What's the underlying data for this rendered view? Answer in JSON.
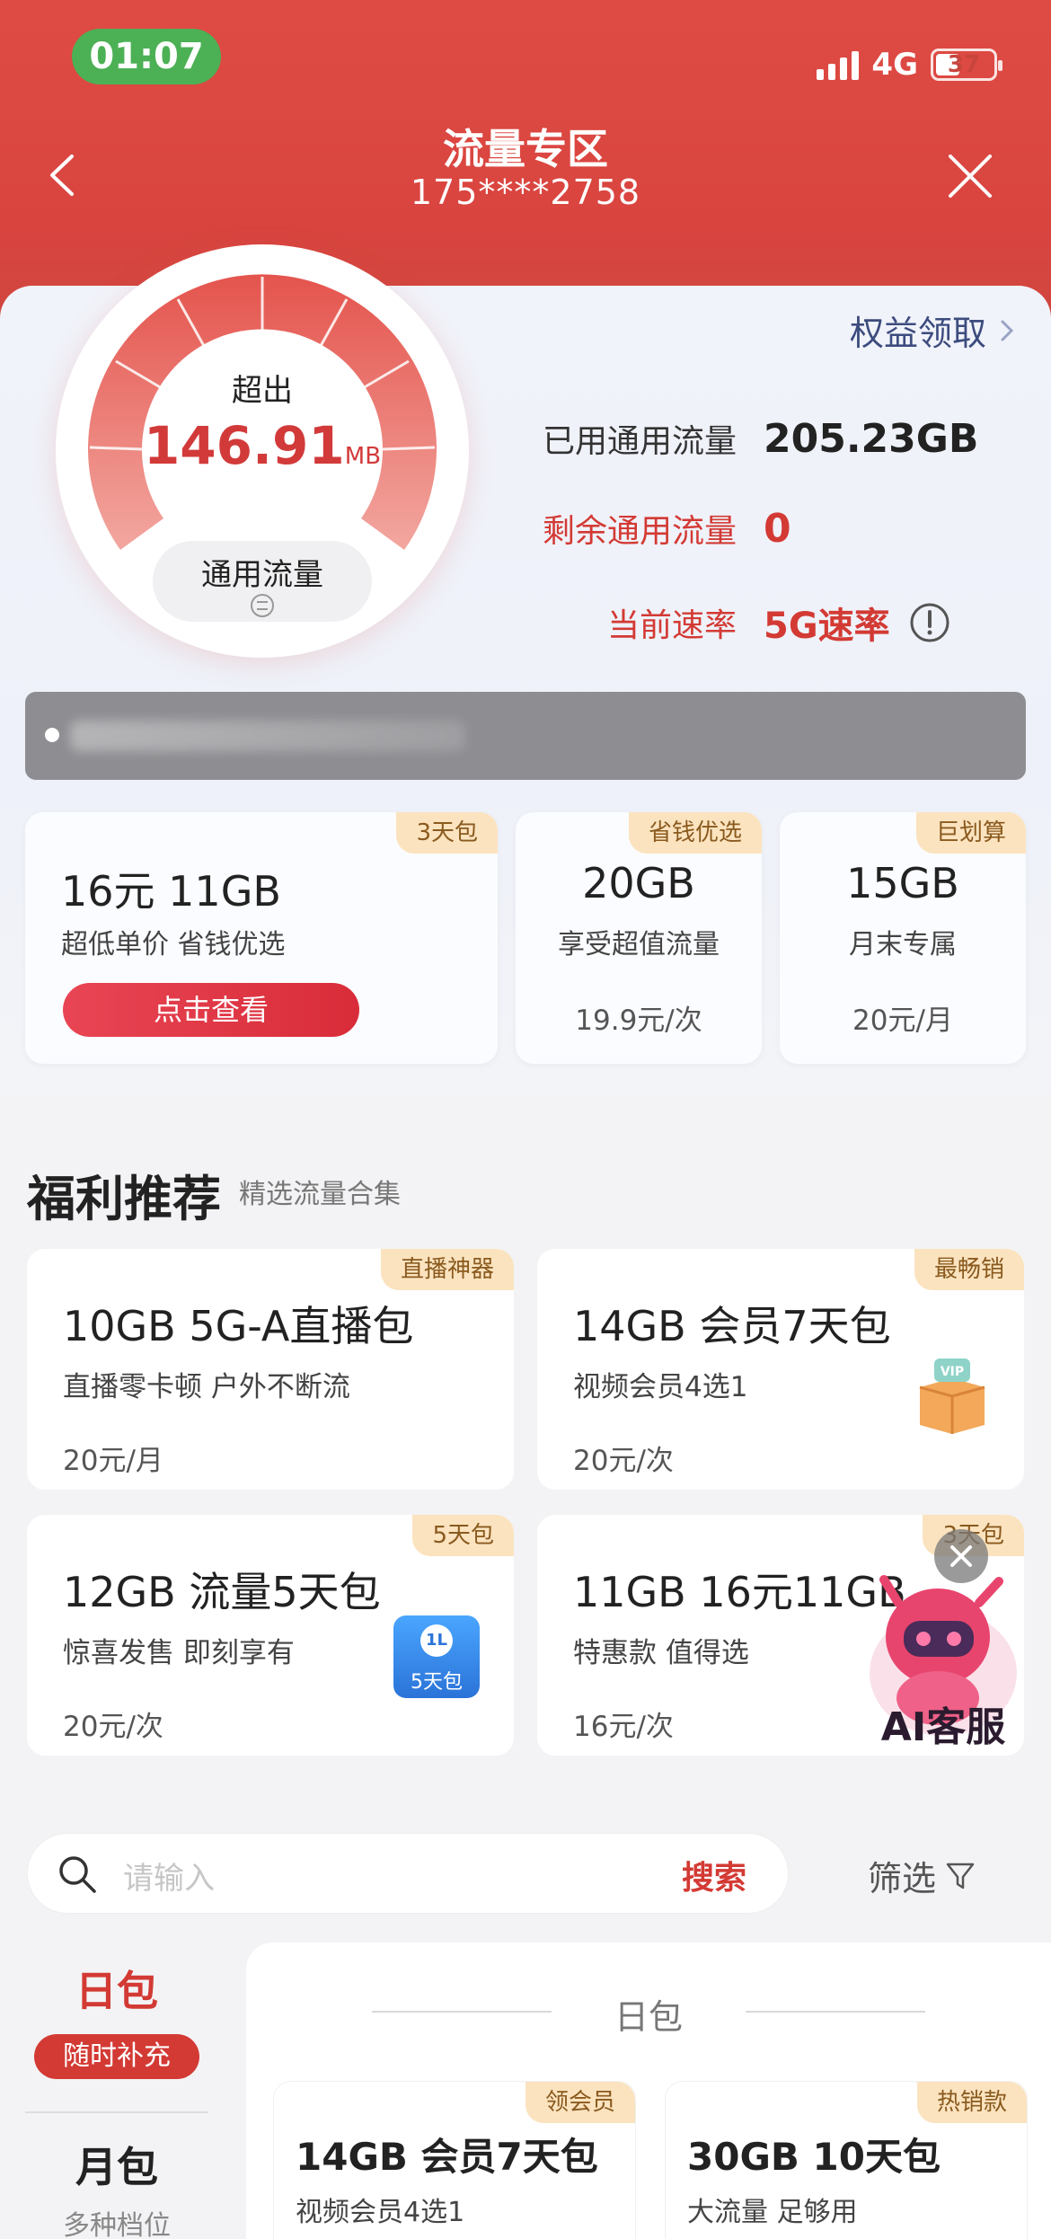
{
  "status_bar": {
    "time": "01:07",
    "network": "4G",
    "battery": "37"
  },
  "header": {
    "title": "流量专区",
    "phone": "175****2758"
  },
  "gauge": {
    "label_top": "超出",
    "value": "146.91",
    "unit": "MB",
    "type_label": "通用流量"
  },
  "rights_link": "权益领取",
  "stats": {
    "used_label": "已用通用流量",
    "used_value": "205.23GB",
    "remain_label": "剩余通用流量",
    "remain_value": "0",
    "speed_label": "当前速率",
    "speed_value": "5G速率"
  },
  "top_packages": [
    {
      "tag": "3天包",
      "title": "16元 11GB",
      "desc": "超低单价 省钱优选",
      "button": "点击查看"
    },
    {
      "tag": "省钱优选",
      "title": "20GB",
      "desc": "享受超值流量",
      "price": "19.9元/次"
    },
    {
      "tag": "巨划算",
      "title": "15GB",
      "desc": "月末专属",
      "price": "20元/月"
    }
  ],
  "welfare": {
    "title": "福利推荐",
    "subtitle": "精选流量合集",
    "items": [
      {
        "tag": "直播神器",
        "title": "10GB  5G-A直播包",
        "desc": "直播零卡顿 户外不断流",
        "price": "20元/月"
      },
      {
        "tag": "最畅销",
        "title": "14GB  会员7天包",
        "desc": "视频会员4选1",
        "price": "20元/次"
      },
      {
        "tag": "5天包",
        "title": "12GB  流量5天包",
        "desc": "惊喜发售 即刻享有",
        "price": "20元/次",
        "icon_text": "5天包"
      },
      {
        "tag": "3天包",
        "title": "11GB  16元11GB",
        "desc": "特惠款 值得选",
        "price": "16元/次"
      }
    ]
  },
  "ai_service": "AI客服",
  "search": {
    "placeholder": "请输入",
    "button": "搜索",
    "filter": "筛选"
  },
  "left_nav": [
    {
      "label": "日包",
      "badge": "随时补充",
      "active": true
    },
    {
      "label": "月包",
      "sub": "多种档位",
      "active": false
    }
  ],
  "right_panel": {
    "header": "日包",
    "items": [
      {
        "tag": "领会员",
        "title": "14GB 会员7天包",
        "desc": "视频会员4选1"
      },
      {
        "tag": "热销款",
        "title": "30GB 10天包",
        "desc": "大流量 足够用"
      }
    ]
  },
  "colors": {
    "brand_red": "#d9443f",
    "accent_red": "#d33a34",
    "tag_bg": "#fbe3bf",
    "status_green": "#4cb055"
  }
}
